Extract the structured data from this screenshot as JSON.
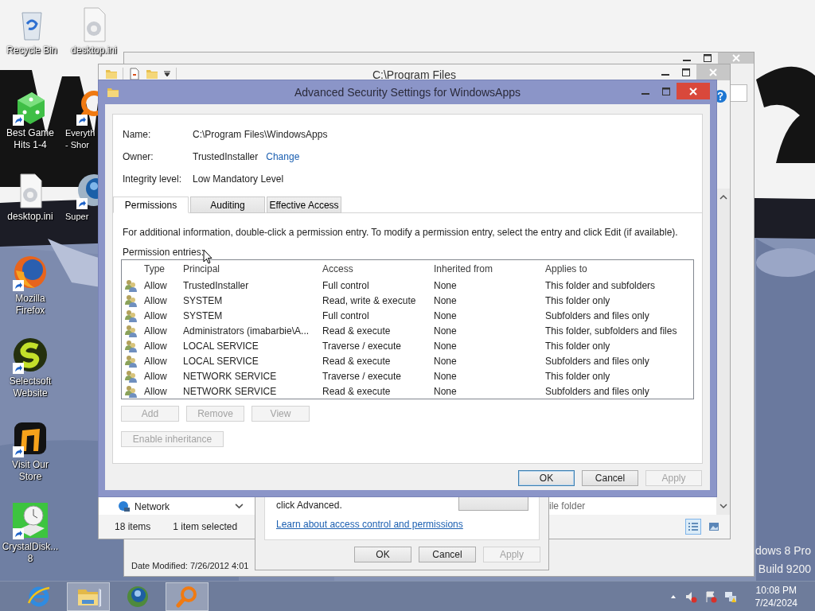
{
  "desktop": {
    "icons": [
      {
        "label": "Recycle Bin",
        "kind": "recycle",
        "shortcut": false
      },
      {
        "label": "desktop.ini",
        "kind": "ini",
        "shortcut": false
      },
      {
        "label": "Best Game Hits 1-4",
        "kind": "dice",
        "shortcut": true
      },
      {
        "label": "Everyth - Shor",
        "kind": "search",
        "shortcut": true
      },
      {
        "label": "desktop.ini",
        "kind": "ini",
        "shortcut": false
      },
      {
        "label": "Super",
        "kind": "globe",
        "shortcut": true
      },
      {
        "label": "Mozilla Firefox",
        "kind": "firefox",
        "shortcut": true
      },
      {
        "label": "Selectsoft Website",
        "kind": "selectsoft",
        "shortcut": true
      },
      {
        "label": "Visit Our Store",
        "kind": "store",
        "shortcut": true
      },
      {
        "label": "CrystalDisk... 8",
        "kind": "disk",
        "shortcut": true
      }
    ],
    "edition": "dows 8 Pro",
    "build": "Build 9200"
  },
  "everything_window": {
    "status": "Date Modified: 7/26/2012 4:01"
  },
  "explorer_window": {
    "title": "C:\\Program Files",
    "nav_item": "Network",
    "type_cell": "ile folder",
    "item_count": "18 items",
    "selection": "1 item selected"
  },
  "properties_dialog": {
    "hint": "click Advanced.",
    "link": "Learn about access control and permissions",
    "buttons": [
      {
        "label": "OK",
        "disabled": false
      },
      {
        "label": "Cancel",
        "disabled": false
      },
      {
        "label": "Apply",
        "disabled": true
      }
    ]
  },
  "security_dialog": {
    "title": "Advanced Security Settings for WindowsApps",
    "fields": [
      {
        "label": "Name:",
        "value": "C:\\Program Files\\WindowsApps"
      },
      {
        "label": "Owner:",
        "value": "TrustedInstaller",
        "link": "Change"
      },
      {
        "label": "Integrity level:",
        "value": "Low Mandatory Level"
      }
    ],
    "tabs": [
      {
        "label": "Permissions",
        "selected": true
      },
      {
        "label": "Auditing",
        "selected": false
      },
      {
        "label": "Effective Access",
        "selected": false
      }
    ],
    "info": "For additional information, double-click a permission entry. To modify a permission entry, select the entry and click Edit (if available).",
    "entries_label": "Permission entries:",
    "columns": [
      "Type",
      "Principal",
      "Access",
      "Inherited from",
      "Applies to"
    ],
    "rows": [
      {
        "type": "Allow",
        "principal": "TrustedInstaller",
        "access": "Full control",
        "inherited": "None",
        "applies": "This folder and subfolders"
      },
      {
        "type": "Allow",
        "principal": "SYSTEM",
        "access": "Read, write & execute",
        "inherited": "None",
        "applies": "This folder only"
      },
      {
        "type": "Allow",
        "principal": "SYSTEM",
        "access": "Full control",
        "inherited": "None",
        "applies": "Subfolders and files only"
      },
      {
        "type": "Allow",
        "principal": "Administrators (imabarbie\\A...",
        "access": "Read & execute",
        "inherited": "None",
        "applies": "This folder, subfolders and files"
      },
      {
        "type": "Allow",
        "principal": "LOCAL SERVICE",
        "access": "Traverse / execute",
        "inherited": "None",
        "applies": "This folder only"
      },
      {
        "type": "Allow",
        "principal": "LOCAL SERVICE",
        "access": "Read & execute",
        "inherited": "None",
        "applies": "Subfolders and files only"
      },
      {
        "type": "Allow",
        "principal": "NETWORK SERVICE",
        "access": "Traverse / execute",
        "inherited": "None",
        "applies": "This folder only"
      },
      {
        "type": "Allow",
        "principal": "NETWORK SERVICE",
        "access": "Read & execute",
        "inherited": "None",
        "applies": "Subfolders and files only"
      }
    ],
    "entry_buttons": [
      {
        "label": "Add",
        "disabled": true
      },
      {
        "label": "Remove",
        "disabled": true
      },
      {
        "label": "View",
        "disabled": true
      }
    ],
    "inheritance_button": {
      "label": "Enable inheritance",
      "disabled": true
    },
    "buttons": [
      {
        "label": "OK",
        "disabled": false,
        "focused": true
      },
      {
        "label": "Cancel",
        "disabled": false,
        "focused": false
      },
      {
        "label": "Apply",
        "disabled": true,
        "focused": false
      }
    ]
  },
  "taskbar": {
    "apps": [
      {
        "kind": "ie",
        "active": false
      },
      {
        "kind": "explorer",
        "active": true
      },
      {
        "kind": "globe",
        "active": false
      },
      {
        "kind": "search",
        "active": true
      }
    ],
    "clock": {
      "time": "10:08 PM",
      "date": "7/24/2024"
    }
  }
}
